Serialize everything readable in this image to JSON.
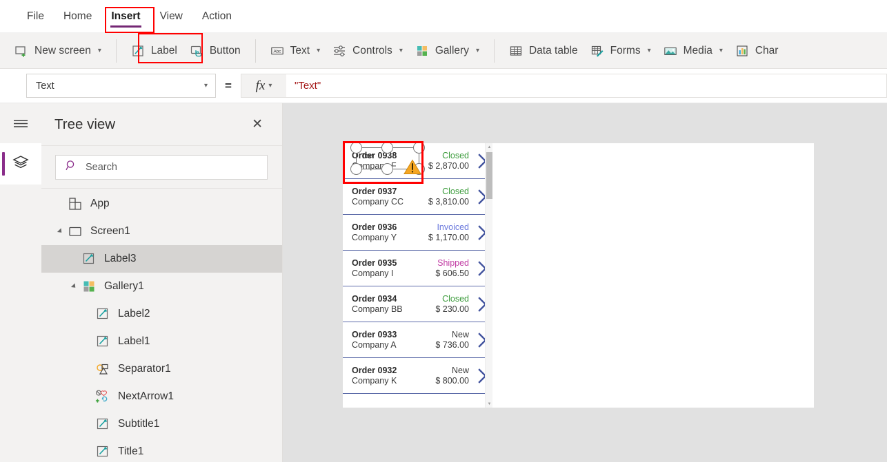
{
  "menu": {
    "items": [
      {
        "label": "File",
        "active": false
      },
      {
        "label": "Home",
        "active": false
      },
      {
        "label": "Insert",
        "active": true
      },
      {
        "label": "View",
        "active": false
      },
      {
        "label": "Action",
        "active": false
      }
    ]
  },
  "ribbon": {
    "items": [
      {
        "label": "New screen",
        "icon": "new-screen-icon",
        "caret": true
      },
      {
        "label": "Label",
        "icon": "label-icon",
        "caret": false
      },
      {
        "label": "Button",
        "icon": "button-icon",
        "caret": false
      },
      {
        "label": "Text",
        "icon": "text-abc-icon",
        "caret": true
      },
      {
        "label": "Controls",
        "icon": "controls-sliders-icon",
        "caret": true
      },
      {
        "label": "Gallery",
        "icon": "gallery-squares-icon",
        "caret": true
      },
      {
        "label": "Data table",
        "icon": "data-table-icon",
        "caret": false
      },
      {
        "label": "Forms",
        "icon": "forms-icon",
        "caret": true
      },
      {
        "label": "Media",
        "icon": "media-image-icon",
        "caret": true
      },
      {
        "label": "Char",
        "icon": "charts-icon",
        "caret": false
      }
    ]
  },
  "formula_bar": {
    "property": "Text",
    "equals": "=",
    "fx_label": "fx",
    "value": "\"Text\""
  },
  "rail": {
    "hamburger": "hamburger-menu-icon",
    "tree_tile": "layers-icon"
  },
  "tree_view": {
    "title": "Tree view",
    "close": "✕",
    "search": {
      "placeholder": "Search",
      "value": ""
    },
    "items": [
      {
        "label": "App",
        "icon": "app-icon",
        "indent": 0,
        "expander": "none",
        "selected": false
      },
      {
        "label": "Screen1",
        "icon": "screen-icon",
        "indent": 0,
        "expander": "expanded",
        "selected": false
      },
      {
        "label": "Label3",
        "icon": "label-icon",
        "indent": 1,
        "expander": "none",
        "selected": true
      },
      {
        "label": "Gallery1",
        "icon": "gallery-icon",
        "indent": 1,
        "expander": "expanded",
        "selected": false
      },
      {
        "label": "Label2",
        "icon": "label-icon",
        "indent": 2,
        "expander": "none",
        "selected": false
      },
      {
        "label": "Label1",
        "icon": "label-icon",
        "indent": 2,
        "expander": "none",
        "selected": false
      },
      {
        "label": "Separator1",
        "icon": "separator-icon",
        "indent": 2,
        "expander": "none",
        "selected": false
      },
      {
        "label": "NextArrow1",
        "icon": "nextarrow-icon",
        "indent": 2,
        "expander": "none",
        "selected": false
      },
      {
        "label": "Subtitle1",
        "icon": "label-icon",
        "indent": 2,
        "expander": "none",
        "selected": false
      },
      {
        "label": "Title1",
        "icon": "label-icon",
        "indent": 2,
        "expander": "none",
        "selected": false
      }
    ]
  },
  "canvas": {
    "selected_control": {
      "text": "Text",
      "warning_icon": "warning-triangle-icon"
    },
    "gallery": {
      "rows": [
        {
          "title": "Order 0938",
          "subtitle": "Company F",
          "status": "Closed",
          "status_color": "#3b9b3b",
          "amount": "$ 2,870.00"
        },
        {
          "title": "Order 0937",
          "subtitle": "Company CC",
          "status": "Closed",
          "status_color": "#3b9b3b",
          "amount": "$ 3,810.00"
        },
        {
          "title": "Order 0936",
          "subtitle": "Company Y",
          "status": "Invoiced",
          "status_color": "#6b79dd",
          "amount": "$ 1,170.00"
        },
        {
          "title": "Order 0935",
          "subtitle": "Company I",
          "status": "Shipped",
          "status_color": "#c23fa5",
          "amount": "$ 606.50"
        },
        {
          "title": "Order 0934",
          "subtitle": "Company BB",
          "status": "Closed",
          "status_color": "#3b9b3b",
          "amount": "$ 230.00"
        },
        {
          "title": "Order 0933",
          "subtitle": "Company A",
          "status": "New",
          "status_color": "#3a3a3a",
          "amount": "$ 736.00"
        },
        {
          "title": "Order 0932",
          "subtitle": "Company K",
          "status": "New",
          "status_color": "#3a3a3a",
          "amount": "$ 800.00"
        }
      ]
    }
  },
  "colors": {
    "accent_purple": "#742774",
    "highlight_red": "#ff0000",
    "chevron_blue": "#42539e",
    "ribbon_bg": "#f3f2f1",
    "canvas_bg": "#e1e1e1"
  }
}
